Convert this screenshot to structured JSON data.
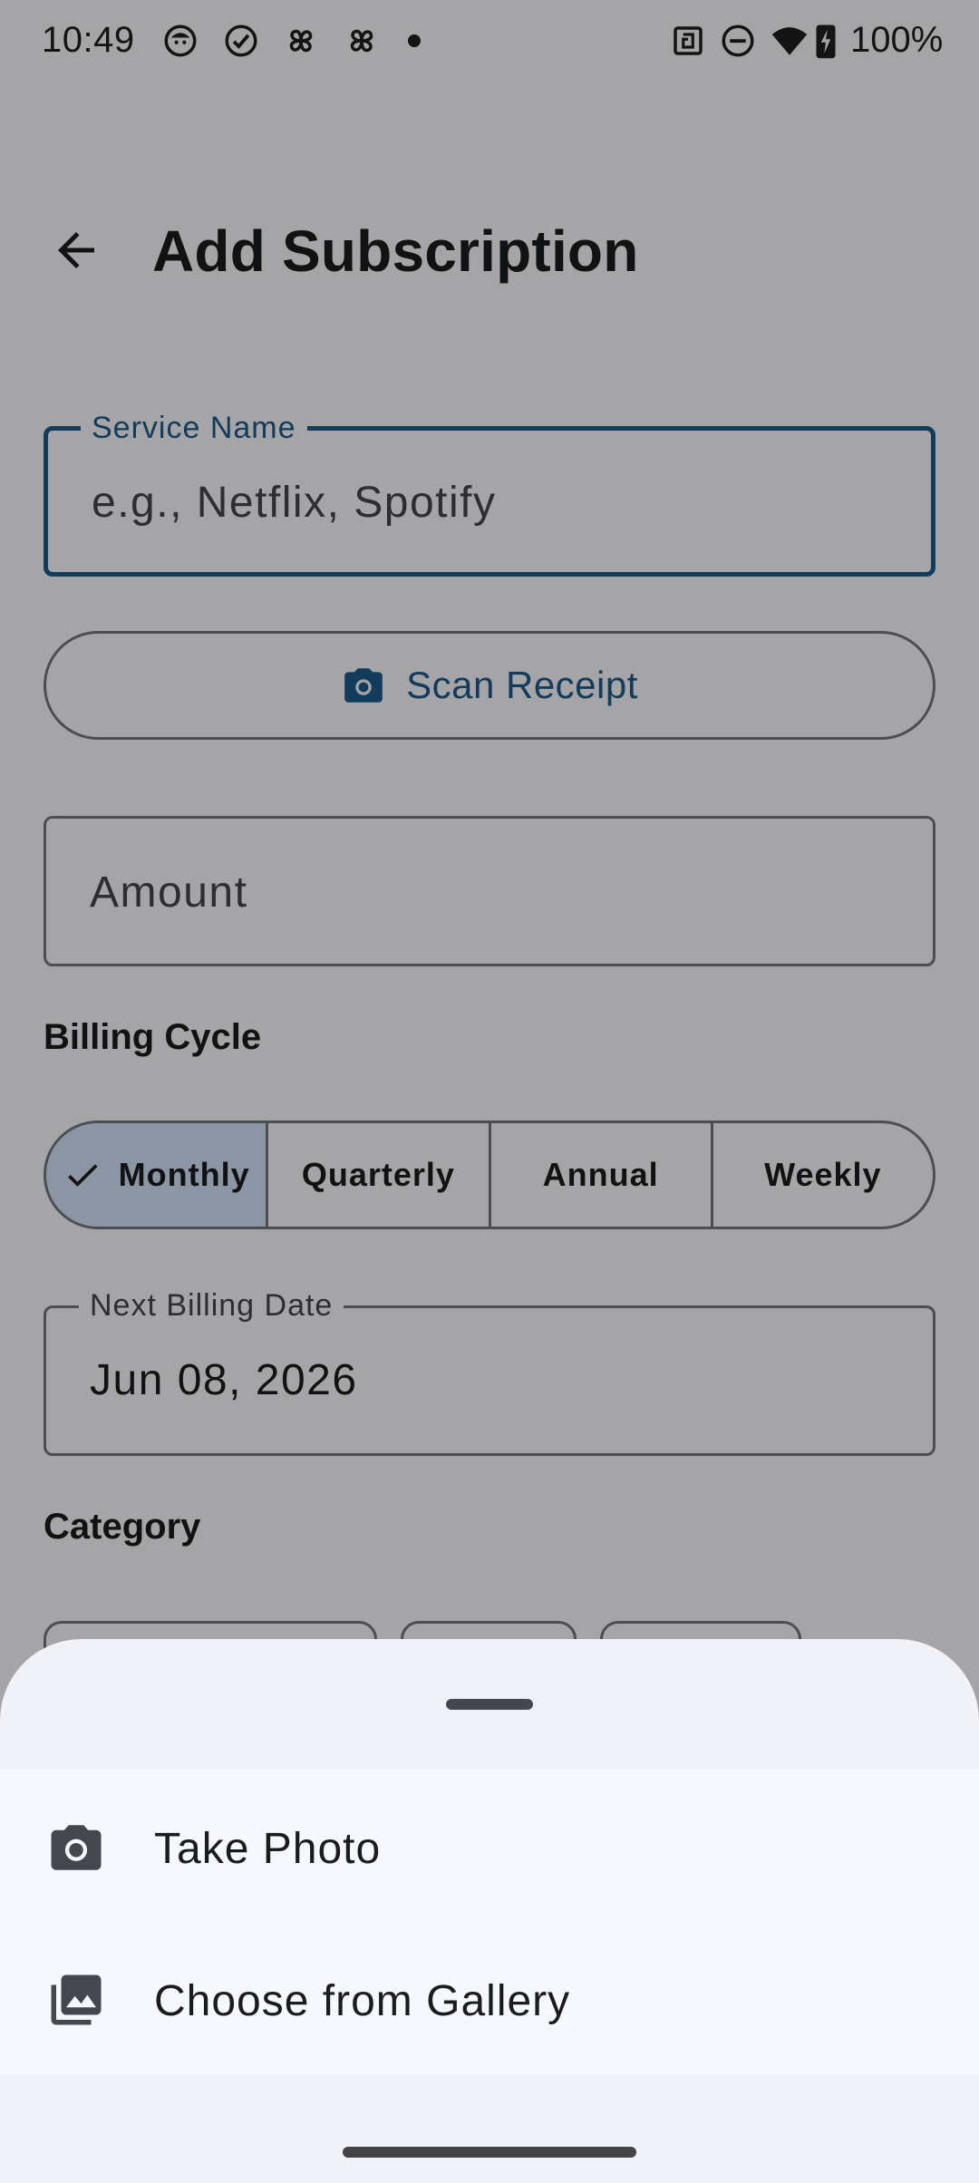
{
  "status_bar": {
    "time": "10:49",
    "battery": "100%",
    "notification_icons": [
      "face-icon",
      "check-circle-icon",
      "pinwheel-icon",
      "pinwheel-icon",
      "dot-icon"
    ],
    "system_icons": [
      "nfc-icon",
      "do-not-disturb-icon",
      "wifi-icon",
      "battery-charging-icon"
    ]
  },
  "app_bar": {
    "title": "Add Subscription",
    "back_icon": "arrow-back-icon"
  },
  "form": {
    "service_name": {
      "label": "Service Name",
      "placeholder": "e.g., Netflix, Spotify",
      "value": ""
    },
    "scan_receipt": {
      "label": "Scan Receipt",
      "icon": "camera-icon"
    },
    "amount": {
      "placeholder": "Amount",
      "value": ""
    },
    "billing_cycle": {
      "label": "Billing Cycle",
      "options": [
        "Monthly",
        "Quarterly",
        "Annual",
        "Weekly"
      ],
      "selected": "Monthly"
    },
    "next_billing_date": {
      "label": "Next Billing Date",
      "value": "Jun 08, 2026"
    },
    "category": {
      "label": "Category"
    }
  },
  "bottom_sheet": {
    "items": [
      {
        "label": "Take Photo",
        "icon": "camera-icon"
      },
      {
        "label": "Choose from Gallery",
        "icon": "photo-library-icon"
      }
    ]
  },
  "colors": {
    "primary": "#1e5a8c",
    "outline": "#73777f",
    "selected_segment": "#d4e3f7",
    "sheet_surface": "#f1f2f7"
  }
}
